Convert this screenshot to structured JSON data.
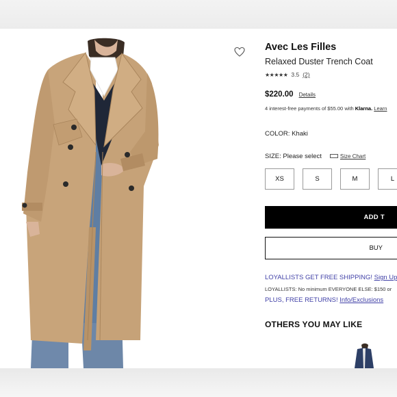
{
  "product": {
    "brand": "Avec Les Filles",
    "name": "Relaxed Duster Trench Coat",
    "rating_stars": "★★★★★",
    "rating_value": "3.5",
    "rating_count": "(2)",
    "price": "$220.00",
    "price_details_label": "Details",
    "installments_text": "4 interest-free payments of $55.00 with",
    "klarna_label": "Klarna.",
    "learn_more_label": "Learn",
    "color_label": "COLOR:",
    "color_value": "Khaki",
    "size_label": "SIZE:",
    "size_value": "Please select",
    "size_chart_label": "Size Chart",
    "sizes": [
      "XS",
      "S",
      "M",
      "L"
    ],
    "add_to_bag_label": "ADD T",
    "buy_label": "BUY"
  },
  "loyalty": {
    "line1_text": "LOYALLISTS GET FREE SHIPPING!",
    "line1_link": "Sign Up",
    "line2_text": "LOYALLISTS: No minimum EVERYONE ELSE: $150 or",
    "line3_text": "PLUS, FREE RETURNS!",
    "line3_link": "Info/Exclusions"
  },
  "recommendations": {
    "title": "OTHERS YOU MAY LIKE"
  },
  "icons": {
    "wishlist": "heart-outline-icon",
    "size_chart": "ruler-icon"
  },
  "colors": {
    "loyalty_link": "#3f3fa6",
    "add_button_bg": "#000000",
    "coat": "#c9a47a"
  }
}
